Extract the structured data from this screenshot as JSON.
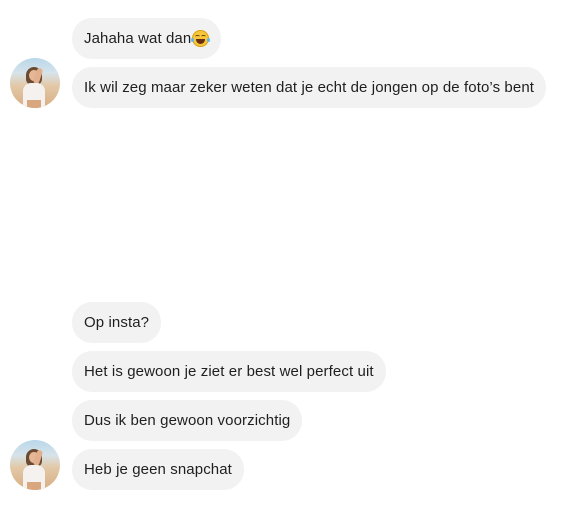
{
  "conversation": {
    "messages": [
      {
        "text": "Jahaha wat dan",
        "emoji": "grinning-squinting-face-with-tears"
      },
      {
        "text": "Ik wil zeg maar zeker weten dat je echt de jongen op de foto’s bent"
      },
      {
        "text": "Op insta?"
      },
      {
        "text": "Het is gewoon je ziet er best wel perfect uit"
      },
      {
        "text": "Dus ik ben gewoon voorzichtig"
      },
      {
        "text": "Heb je geen snapchat"
      }
    ],
    "avatar": {
      "icon": "profile-photo-avatar"
    },
    "colors": {
      "bubble": "#f2f2f3",
      "text": "#1f1f1f",
      "background": "#ffffff"
    }
  }
}
